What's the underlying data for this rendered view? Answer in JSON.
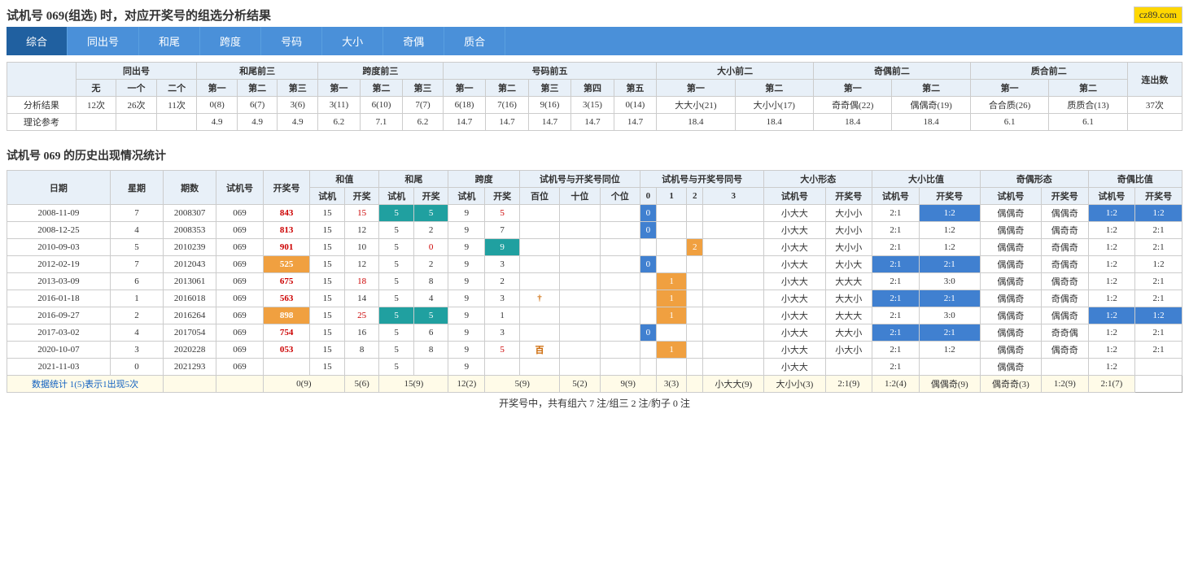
{
  "page": {
    "title": "试机号 069(组选) 时，对应开奖号的组选分析结果",
    "brand": "cz89.com"
  },
  "tabs": [
    {
      "label": "综合",
      "active": true
    },
    {
      "label": "同出号",
      "active": false
    },
    {
      "label": "和尾",
      "active": false
    },
    {
      "label": "跨度",
      "active": false
    },
    {
      "label": "号码",
      "active": false
    },
    {
      "label": "大小",
      "active": false
    },
    {
      "label": "奇偶",
      "active": false
    },
    {
      "label": "质合",
      "active": false
    }
  ],
  "analysis": {
    "section1_title": "分析结果",
    "section2_title": "理论参考",
    "headers": {
      "tongchu": "同出号",
      "hewei": "和尾前三",
      "kuadu": "跨度前三",
      "hama": "号码前五",
      "daxiao": "大小前二",
      "jioyu": "奇偶前二",
      "zhihe": "质合前二",
      "lianchushu": "连出数"
    },
    "rows": {
      "analysis": [
        "分析结果",
        "12次",
        "26次",
        "11次",
        "0(8)",
        "6(7)",
        "3(6)",
        "3(11)",
        "6(10)",
        "7(7)",
        "6(18)",
        "7(16)",
        "9(16)",
        "3(15)",
        "0(14)",
        "大大小(21)",
        "大小小(17)",
        "奇奇偶(22)",
        "偶偶奇(19)",
        "合合质(26)",
        "质质合(13)",
        "37次"
      ],
      "theory": [
        "理论参考",
        "",
        "",
        "",
        "4.9",
        "4.9",
        "4.9",
        "6.2",
        "7.1",
        "6.2",
        "14.7",
        "14.7",
        "14.7",
        "14.7",
        "14.7",
        "18.4",
        "18.4",
        "18.4",
        "18.4",
        "6.1",
        "6.1",
        ""
      ]
    }
  },
  "history": {
    "section_title": "试机号 069 的历史出现情况统计",
    "col_headers": {
      "date": "日期",
      "weekday": "星期",
      "period": "期数",
      "test_num": "试机号",
      "prize_num": "开奖号",
      "heZhi_test": "试机",
      "heZhi_prize": "开奖",
      "hewei_test": "试机",
      "hewei_prize": "开奖",
      "kuadu_test": "试机",
      "kuadu_prize": "开奖",
      "pos100": "百位",
      "pos10": "十位",
      "pos1": "个位",
      "same0": "0",
      "same1": "1",
      "same2": "2",
      "same3": "3",
      "daxiao_test": "试机号",
      "daxiao_prize": "开奖号",
      "daXiaoRatio_test": "试机号",
      "daXiaoRatio_prize": "开奖号",
      "jiOu_test": "试机号",
      "jiOu_prize": "开奖号",
      "jiOuRatio_test": "试机号",
      "jiOuRatio_prize": "开奖号"
    },
    "rows": [
      {
        "date": "2008-11-09",
        "week": "7",
        "period": "2008307",
        "test": "069",
        "prize": "843",
        "ht": 15,
        "hp": 15,
        "hwt": 5,
        "hwp": 5,
        "kdt": 9,
        "kdp": 5,
        "p100": "",
        "p10": "",
        "p1": "",
        "s0": "0",
        "s1": "",
        "s2": "",
        "s3": "",
        "dxt": "小大大",
        "dxp": "大小小",
        "dxrt": "2:1",
        "dxrp": "1:2",
        "jot": "偶偶奇",
        "jop": "偶偶奇",
        "jort": "1:2",
        "jorp": "1:2",
        "hw_hi": true,
        "hd_hi": false
      },
      {
        "date": "2008-12-25",
        "week": "4",
        "period": "2008353",
        "test": "069",
        "prize": "813",
        "ht": 15,
        "hp": 12,
        "hwt": 5,
        "hwp": 2,
        "kdt": 9,
        "kdp": 7,
        "p100": "",
        "p10": "",
        "p1": "",
        "s0": "0",
        "s1": "",
        "s2": "",
        "s3": "",
        "dxt": "小大大",
        "dxp": "大小小",
        "dxrt": "2:1",
        "dxrp": "1:2",
        "jot": "偶偶奇",
        "jop": "偶奇奇",
        "jort": "1:2",
        "jorp": "2:1",
        "hw_hi": false,
        "hd_hi": false
      },
      {
        "date": "2010-09-03",
        "week": "5",
        "period": "2010239",
        "test": "069",
        "prize": "901",
        "ht": 15,
        "hp": 10,
        "hwt": 5,
        "hwp": 0,
        "kdt": 9,
        "kdp": 9,
        "p100": "",
        "p10": "",
        "p1": "",
        "s0": "",
        "s1": "",
        "s2": "2",
        "s3": "",
        "dxt": "小大大",
        "dxp": "大小小",
        "dxrt": "2:1",
        "dxrp": "1:2",
        "jot": "偶偶奇",
        "jop": "奇偶奇",
        "jort": "1:2",
        "jorp": "2:1",
        "hw_hi": false,
        "hd_hi": true
      },
      {
        "date": "2012-02-19",
        "week": "7",
        "period": "2012043",
        "test": "069",
        "prize": "525",
        "ht": 15,
        "hp": 12,
        "hwt": 5,
        "hwp": 2,
        "kdt": 9,
        "kdp": 3,
        "p100": "",
        "p10": "",
        "p1": "",
        "s0": "0",
        "s1": "",
        "s2": "",
        "s3": "",
        "dxt": "小大大",
        "dxp": "大小大",
        "dxrt": "2:1",
        "dxrp": "2:1",
        "jot": "偶偶奇",
        "jop": "奇偶奇",
        "jort": "1:2",
        "jorp": "1:2",
        "hw_hi": false,
        "hd_hi": false,
        "prize_hi": true
      },
      {
        "date": "2013-03-09",
        "week": "6",
        "period": "2013061",
        "test": "069",
        "prize": "675",
        "ht": 15,
        "hp": 18,
        "hwt": 5,
        "hwp": 8,
        "kdt": 9,
        "kdp": 2,
        "p100": "",
        "p10": "",
        "p1": "",
        "s0": "",
        "s1": "1",
        "s2": "",
        "s3": "",
        "dxt": "小大大",
        "dxp": "大大大",
        "dxrt": "2:1",
        "dxrp": "3:0",
        "jot": "偶偶奇",
        "jop": "偶奇奇",
        "jort": "1:2",
        "jorp": "2:1",
        "hw_hi": false,
        "hd_hi": false
      },
      {
        "date": "2016-01-18",
        "week": "1",
        "period": "2016018",
        "test": "069",
        "prize": "563",
        "ht": 15,
        "hp": 14,
        "hwt": 5,
        "hwp": 4,
        "kdt": 9,
        "kdp": 3,
        "p100": "†",
        "p10": "",
        "p1": "",
        "s0": "",
        "s1": "1",
        "s2": "",
        "s3": "",
        "dxt": "小大大",
        "dxp": "大大小",
        "dxrt": "2:1",
        "dxrp": "2:1",
        "jot": "偶偶奇",
        "jop": "奇偶奇",
        "jort": "1:2",
        "jorp": "2:1",
        "hw_hi": false,
        "hd_hi": false
      },
      {
        "date": "2016-09-27",
        "week": "2",
        "period": "2016264",
        "test": "069",
        "prize": "898",
        "ht": 15,
        "hp": 25,
        "hwt": 5,
        "hwp": 5,
        "kdt": 9,
        "kdp": 1,
        "p100": "",
        "p10": "",
        "p1": "",
        "s0": "",
        "s1": "1",
        "s2": "",
        "s3": "",
        "dxt": "小大大",
        "dxp": "大大大",
        "dxrt": "2:1",
        "dxrp": "3:0",
        "jot": "偶偶奇",
        "jop": "偶偶奇",
        "jort": "1:2",
        "jorp": "1:2",
        "hw_hi": true,
        "hd_hi": false,
        "prize_hi2": true
      },
      {
        "date": "2017-03-02",
        "week": "4",
        "period": "2017054",
        "test": "069",
        "prize": "754",
        "ht": 15,
        "hp": 16,
        "hwt": 5,
        "hwp": 6,
        "kdt": 9,
        "kdp": 3,
        "p100": "",
        "p10": "",
        "p1": "",
        "s0": "0",
        "s1": "",
        "s2": "",
        "s3": "",
        "dxt": "小大大",
        "dxp": "大大小",
        "dxrt": "2:1",
        "dxrp": "2:1",
        "jot": "偶偶奇",
        "jop": "奇奇偶",
        "jort": "1:2",
        "jorp": "2:1",
        "hw_hi": false,
        "hd_hi": false
      },
      {
        "date": "2020-10-07",
        "week": "3",
        "period": "2020228",
        "test": "069",
        "prize": "053",
        "ht": 15,
        "hp": 8,
        "hwt": 5,
        "hwp": 8,
        "kdt": 9,
        "kdp": 5,
        "p100": "百",
        "p10": "",
        "p1": "",
        "s0": "",
        "s1": "1",
        "s2": "",
        "s3": "",
        "dxt": "小大大",
        "dxp": "小大小",
        "dxrt": "2:1",
        "dxrp": "1:2",
        "jot": "偶偶奇",
        "jop": "偶奇奇",
        "jort": "1:2",
        "jorp": "2:1",
        "hw_hi": false,
        "hd_hi": false
      },
      {
        "date": "2021-11-03",
        "week": "0",
        "period": "2021293",
        "test": "069",
        "prize": "",
        "ht": 15,
        "hp": "",
        "hwt": 5,
        "hwp": "",
        "kdt": 9,
        "kdp": "",
        "p100": "",
        "p10": "",
        "p1": "",
        "s0": "",
        "s1": "",
        "s2": "",
        "s3": "",
        "dxt": "小大大",
        "dxp": "",
        "dxrt": "2:1",
        "dxrp": "",
        "jot": "偶偶奇",
        "jop": "",
        "jort": "1:2",
        "jorp": "",
        "hw_hi": false,
        "hd_hi": false
      }
    ],
    "stats_row": {
      "label": "数据统计",
      "note": "1(5)表示1出现5次",
      "v1": "0(9)",
      "v2": "5(6)",
      "v3": "15(9)",
      "v4": "12(2)",
      "v5": "5(9)",
      "v6": "5(2)",
      "v7": "9(9)",
      "v8": "3(3)",
      "dxt": "小大大(9)",
      "dxp": "大小小(3)",
      "dxrt": "2:1(9)",
      "dxrp": "1:2(4)",
      "jot": "偶偶奇(9)",
      "jop": "偶奇奇(3)",
      "jort": "1:2(9)",
      "jorp": "2:1(7)"
    },
    "footer": "开奖号中，共有组六 7 注/组三 2 注/豹子 0 注"
  }
}
